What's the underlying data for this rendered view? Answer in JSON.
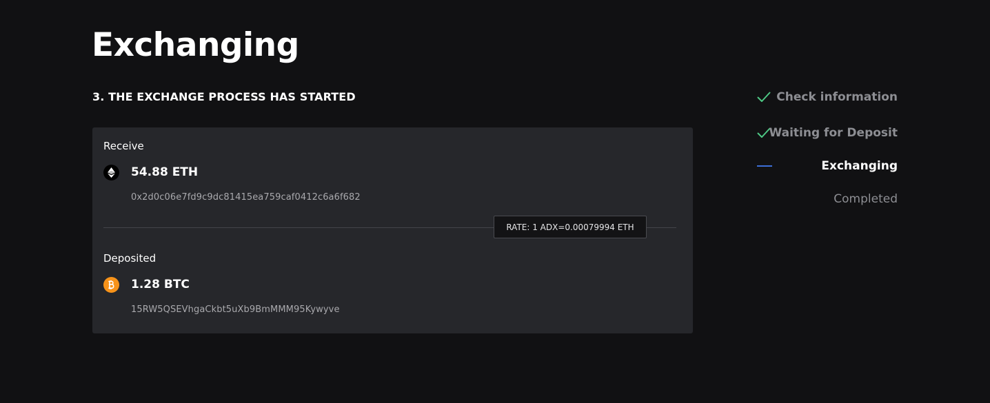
{
  "page": {
    "title": "Exchanging",
    "step_heading": "3. THE EXCHANGE PROCESS HAS STARTED"
  },
  "receive": {
    "label": "Receive",
    "amount": "54.88 ETH",
    "address": "0x2d0c06e7fd9c9dc81415ea759caf0412c6a6f682",
    "icon": "ethereum-icon"
  },
  "rate": {
    "text": "RATE: 1 ADX=0.00079994 ETH"
  },
  "deposited": {
    "label": "Deposited",
    "amount": "1.28 BTC",
    "address": "15RW5QSEVhgaCkbt5uXb9BmMMM95Kywyve",
    "icon": "bitcoin-icon"
  },
  "steps": [
    {
      "label": "Check information",
      "status": "done"
    },
    {
      "label": "Waiting for Deposit",
      "status": "done"
    },
    {
      "label": "Exchanging",
      "status": "active"
    },
    {
      "label": "Completed",
      "status": "pending"
    }
  ],
  "colors": {
    "background": "#111113",
    "card": "#26272b",
    "check": "#4ec985",
    "active_line": "#3d6fd9",
    "eth_icon_bg": "#000000",
    "btc_icon_bg": "#f7931a"
  }
}
